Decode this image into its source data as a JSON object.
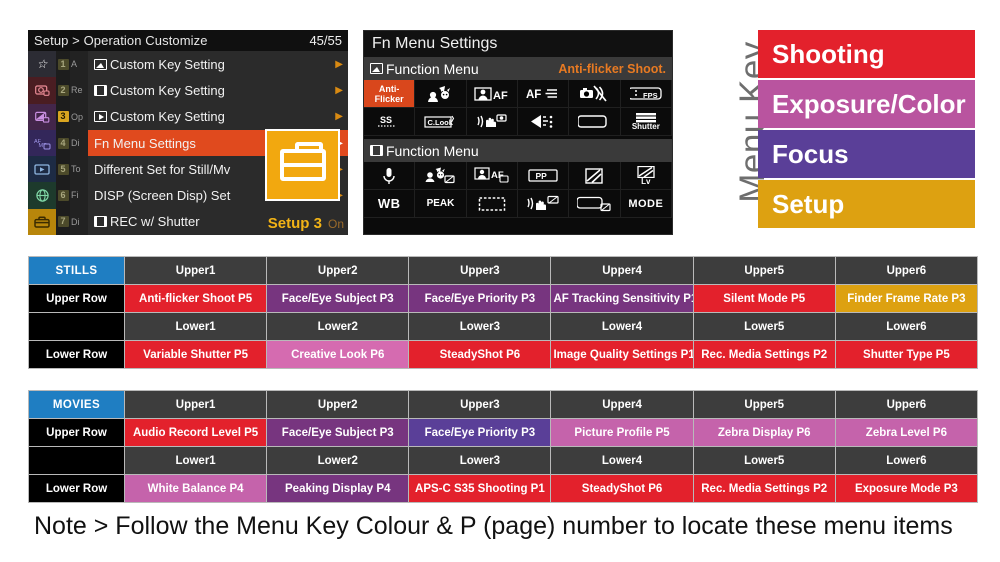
{
  "camera_menu": {
    "breadcrumb": "Setup > Operation Customize",
    "page_counter": "45/55",
    "sidebar_icons": [
      {
        "name": "star-icon",
        "glyph": "☆"
      },
      {
        "name": "camera-shooting-icon",
        "glyph": "■"
      },
      {
        "name": "exposure-color-icon",
        "glyph": "■"
      },
      {
        "name": "af-mf-focus-icon",
        "glyph": "AF"
      },
      {
        "name": "playback-icon",
        "glyph": "▶"
      },
      {
        "name": "network-globe-icon",
        "glyph": "⊕"
      },
      {
        "name": "setup-toolbox-icon",
        "glyph": "■"
      }
    ],
    "tab_numbers": [
      "1",
      "2",
      "3",
      "4",
      "5",
      "6",
      "7"
    ],
    "tab_labels": [
      "A",
      "Re",
      "Op",
      "Di",
      "To",
      "Fi",
      "Di"
    ],
    "active_tab_index": 2,
    "items": [
      {
        "icon": "still-image-icon",
        "label": "Custom Key Setting",
        "arrow": "▶",
        "selected": false
      },
      {
        "icon": "movie-film-icon",
        "label": "Custom Key Setting",
        "arrow": "▶",
        "selected": false
      },
      {
        "icon": "playback-icon",
        "label": "Custom Key Setting",
        "arrow": "▶",
        "selected": false
      },
      {
        "icon": "none",
        "label": "Fn Menu Settings",
        "arrow": "▶",
        "selected": true
      },
      {
        "icon": "none",
        "label": "Different Set for Still/Mv",
        "arrow": "▶",
        "selected": false
      },
      {
        "icon": "none",
        "label": "DISP (Screen Disp) Set",
        "arrow": "▶",
        "selected": false
      },
      {
        "icon": "movie-rec-icon",
        "label": "REC w/ Shutter",
        "arrow": "",
        "selected": false
      }
    ],
    "footer_setup": "Setup 3",
    "footer_value": "On",
    "toolbox_icon": "toolbox-icon"
  },
  "fn_panel": {
    "title": "Fn Menu Settings",
    "still_section": {
      "icon": "still-image-icon",
      "label": "Function Menu",
      "highlight_value": "Anti-flicker Shoot.",
      "upper_row": [
        {
          "name": "anti-flicker-icon",
          "label_line1": "Anti-",
          "label_line2": "Flicker",
          "selected": true
        },
        {
          "name": "face-eye-subject-icon",
          "label": "",
          "selected": false
        },
        {
          "name": "face-eye-af-icon",
          "label": "AF",
          "selected": false
        },
        {
          "name": "af-tracking-sensitivity-icon",
          "label": "AF",
          "selected": false
        },
        {
          "name": "silent-mode-icon",
          "label": "",
          "selected": false
        },
        {
          "name": "finder-frame-rate-icon",
          "label": "FPS",
          "selected": false
        }
      ],
      "lower_row": [
        {
          "name": "variable-shutter-icon",
          "label": "SS",
          "selected": false
        },
        {
          "name": "creative-look-icon",
          "label": "C.Look",
          "selected": false
        },
        {
          "name": "steadyshot-icon",
          "label": "",
          "selected": false
        },
        {
          "name": "image-quality-icon",
          "label": "",
          "selected": false
        },
        {
          "name": "rec-media-settings-icon",
          "label": "",
          "selected": false
        },
        {
          "name": "shutter-type-icon",
          "label": "Shutter",
          "selected": false
        }
      ]
    },
    "movie_section": {
      "icon": "movie-film-icon",
      "label": "Function Menu",
      "upper_row": [
        {
          "name": "audio-record-level-icon",
          "label": "",
          "selected": false
        },
        {
          "name": "face-eye-subject-movie-icon",
          "label": "",
          "selected": false
        },
        {
          "name": "face-eye-priority-af-movie-icon",
          "label": "AF",
          "selected": false
        },
        {
          "name": "picture-profile-icon",
          "label": "PP",
          "selected": false
        },
        {
          "name": "zebra-display-icon",
          "label": "",
          "selected": false
        },
        {
          "name": "zebra-level-icon",
          "label": "Lv",
          "selected": false
        }
      ],
      "lower_row": [
        {
          "name": "white-balance-icon",
          "label": "WB",
          "selected": false
        },
        {
          "name": "peaking-display-icon",
          "label": "PEAK",
          "selected": false
        },
        {
          "name": "aps-c-s35-shooting-icon",
          "label": "",
          "selected": false
        },
        {
          "name": "steadyshot-movie-icon",
          "label": "",
          "selected": false
        },
        {
          "name": "rec-media-settings-movie-icon",
          "label": "",
          "selected": false
        },
        {
          "name": "exposure-mode-icon",
          "label": "MODE",
          "selected": false
        }
      ]
    }
  },
  "menu_key": {
    "title": "Menu Key",
    "blocks": [
      {
        "label": "Shooting",
        "color": "#e3212c"
      },
      {
        "label": "Exposure/Color",
        "color": "#b9549f"
      },
      {
        "label": "Focus",
        "color": "#5a3f98"
      },
      {
        "label": "Setup",
        "color": "#dda111"
      }
    ]
  },
  "stills_table": {
    "heading": "STILLS",
    "upper_row_label": "Upper Row",
    "lower_row_label": "Lower Row",
    "upper_headers": [
      "Upper1",
      "Upper2",
      "Upper3",
      "Upper4",
      "Upper5",
      "Upper6"
    ],
    "lower_headers": [
      "Lower1",
      "Lower2",
      "Lower3",
      "Lower4",
      "Lower5",
      "Lower6"
    ],
    "upper_cells": [
      {
        "label": "Anti-flicker Shoot  P5",
        "color": "#e3212c"
      },
      {
        "label": "Face/Eye Subject  P3",
        "color": "#77357f"
      },
      {
        "label": "Face/Eye Priority  P3",
        "color": "#77357f"
      },
      {
        "label": "AF Tracking Sensitivity  P1",
        "color": "#77357f"
      },
      {
        "label": "Silent Mode  P5",
        "color": "#e3212c"
      },
      {
        "label": "Finder Frame Rate  P3",
        "color": "#dda111"
      }
    ],
    "lower_cells": [
      {
        "label": "Variable Shutter P5",
        "color": "#e3212c"
      },
      {
        "label": "Creative Look P6",
        "color": "#d濫"
      },
      {
        "label": "SteadyShot  P6",
        "color": "#e3212c"
      },
      {
        "label": "Image Quality Settings P1",
        "color": "#e3212c"
      },
      {
        "label": "Rec. Media Settings  P2",
        "color": "#e3212c"
      },
      {
        "label": "Shutter Type  P5",
        "color": "#e3212c"
      }
    ]
  },
  "movies_table": {
    "heading": "MOVIES",
    "upper_row_label": "Upper Row",
    "lower_row_label": "Lower Row",
    "upper_headers": [
      "Upper1",
      "Upper2",
      "Upper3",
      "Upper4",
      "Upper5",
      "Upper6"
    ],
    "lower_headers": [
      "Lower1",
      "Lower2",
      "Lower3",
      "Lower4",
      "Lower5",
      "Lower6"
    ],
    "upper_cells": [
      {
        "label": "Audio Record Level P5",
        "color": "#e3212c"
      },
      {
        "label": "Face/Eye Subject P3",
        "color": "#77357f"
      },
      {
        "label": "Face/Eye Priority P3",
        "color": "#5a3f98"
      },
      {
        "label": "Picture Profile P5",
        "color": "#c563ab"
      },
      {
        "label": "Zebra Display  P6",
        "color": "#c563ab"
      },
      {
        "label": "Zebra Level  P6",
        "color": "#c563ab"
      }
    ],
    "lower_cells": [
      {
        "label": "White Balance  P4",
        "color": "#c563ab"
      },
      {
        "label": "Peaking Display  P4",
        "color": "#77357f"
      },
      {
        "label": "APS-C S35 Shooting  P1",
        "color": "#e3212c"
      },
      {
        "label": "SteadyShot  P6",
        "color": "#e3212c"
      },
      {
        "label": "Rec. Media Settings  P2",
        "color": "#e3212c"
      },
      {
        "label": "Exposure Mode  P3",
        "color": "#e3212c"
      }
    ]
  },
  "note": "Note > Follow the Menu Key Colour & P (page) number to locate these menu items",
  "colors": {
    "shooting": "#e3212c",
    "exposure_color": "#b9549f",
    "exposure_color_light": "#c563ab",
    "focus": "#5a3f98",
    "focus_purple": "#77357f",
    "setup": "#dda111",
    "table_header_blue": "#1f7ec2",
    "table_header_text": "#f5e642",
    "grey_header": "#3d3d3d"
  }
}
